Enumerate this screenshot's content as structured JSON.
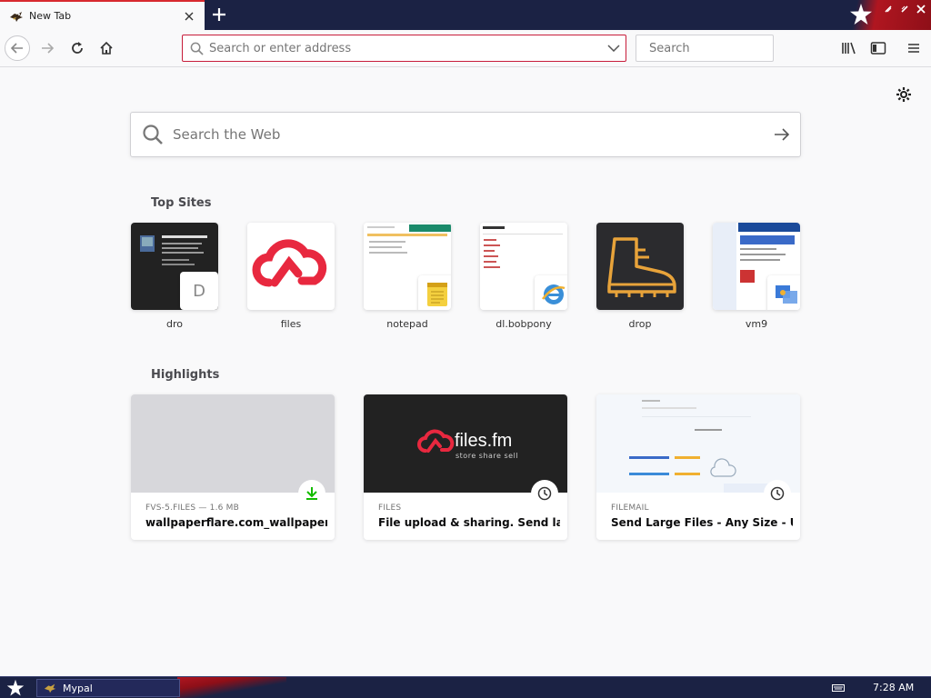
{
  "window": {
    "tab": {
      "title": "New Tab",
      "favicon": "mypal-bird-icon"
    }
  },
  "navbar": {
    "urlbar_placeholder": "Search or enter address",
    "searchbar_placeholder": "Search"
  },
  "newtab": {
    "websearch_placeholder": "Search the Web",
    "topsites_title": "Top Sites",
    "highlights_title": "Highlights",
    "topsites": [
      {
        "label": "dro",
        "badge": "D"
      },
      {
        "label": "files",
        "badge": ""
      },
      {
        "label": "notepad",
        "badge": ""
      },
      {
        "label": "dl.bobpony",
        "badge": ""
      },
      {
        "label": "drop",
        "badge": ""
      },
      {
        "label": "vm9",
        "badge": ""
      }
    ],
    "highlights": [
      {
        "source": "FVS-5.FILES — 1.6 MB",
        "title": "wallpaperflare.com_wallpaper.jpg",
        "badge": "download-icon"
      },
      {
        "source": "FILES",
        "title": "File upload & sharing. Send large...",
        "badge": "clock-icon",
        "logo": "files.fm",
        "logo_tagline": "store share sell"
      },
      {
        "source": "FILEMAIL",
        "title": "Send Large Files - Any Size - Up ...",
        "badge": "clock-icon"
      }
    ]
  },
  "taskbar": {
    "app_label": "Mypal",
    "clock": "7:28 AM"
  },
  "colors": {
    "accent_red": "#d8292f",
    "urlbar_border": "#c71c3a",
    "taskbar_bg": "#1b2244",
    "files_red": "#e8283f",
    "drop_orange": "#e8a33a"
  }
}
